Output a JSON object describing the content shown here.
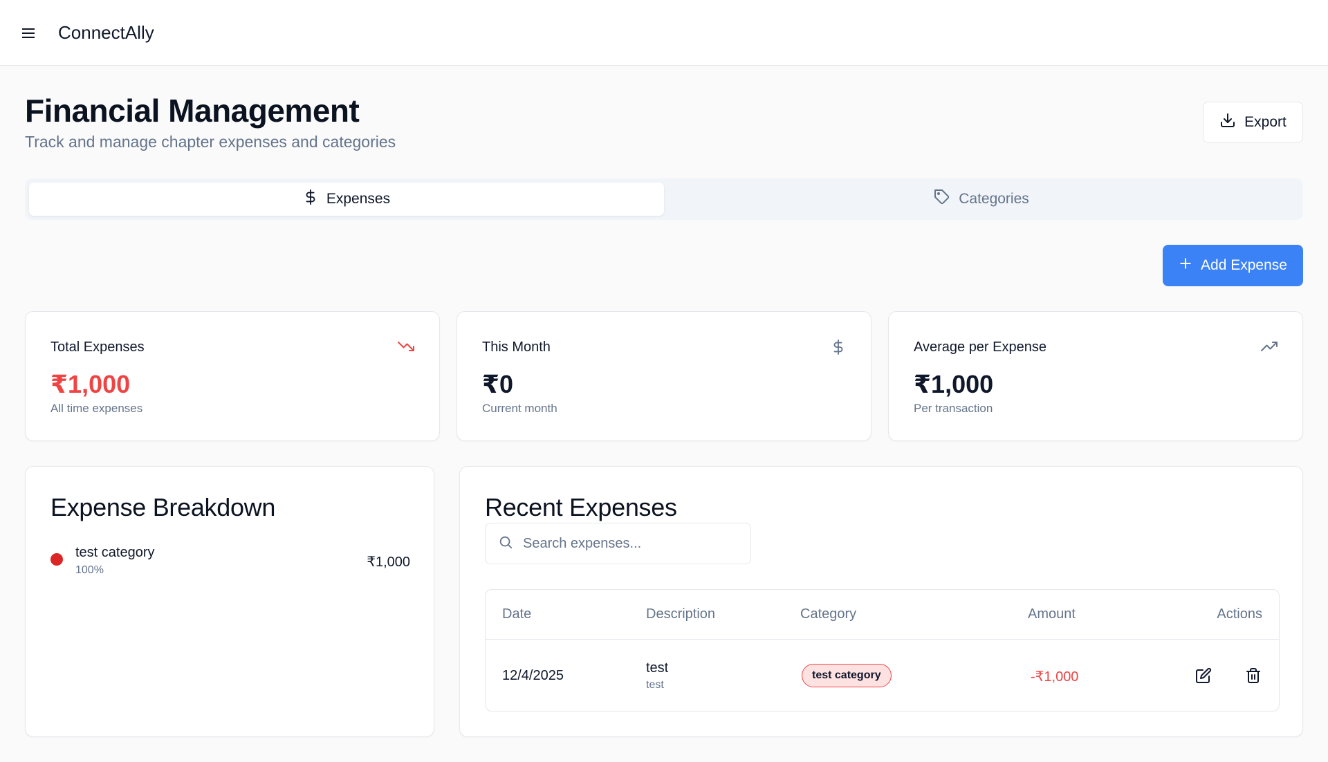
{
  "header": {
    "app_title": "ConnectAlly",
    "menu_icon": "hamburger-menu-icon"
  },
  "page": {
    "title": "Financial Management",
    "subtitle": "Track and manage chapter expenses and categories",
    "export_label": "Export"
  },
  "tabs": [
    {
      "label": "Expenses",
      "icon": "dollar-icon",
      "active": true
    },
    {
      "label": "Categories",
      "icon": "tag-icon",
      "active": false
    }
  ],
  "actions": {
    "add_expense_label": "Add Expense"
  },
  "stats": [
    {
      "label": "Total Expenses",
      "value": "₹1,000",
      "sub": "All time expenses",
      "icon": "trending-down-icon",
      "value_color": "#ef4444",
      "icon_color": "#ef4444"
    },
    {
      "label": "This Month",
      "value": "₹0",
      "sub": "Current month",
      "icon": "dollar-icon",
      "value_color": "#0f172a",
      "icon_color": "#64748b"
    },
    {
      "label": "Average per Expense",
      "value": "₹1,000",
      "sub": "Per transaction",
      "icon": "trending-up-icon",
      "value_color": "#0f172a",
      "icon_color": "#64748b"
    }
  ],
  "breakdown": {
    "title": "Expense Breakdown",
    "items": [
      {
        "name": "test category",
        "percent": "100%",
        "amount": "₹1,000",
        "color": "#dc2626"
      }
    ]
  },
  "recent": {
    "title": "Recent Expenses",
    "search_placeholder": "Search expenses...",
    "columns": [
      "Date",
      "Description",
      "Category",
      "Amount",
      "Actions"
    ],
    "rows": [
      {
        "date": "12/4/2025",
        "description": "test",
        "description_sub": "test",
        "category": "test category",
        "amount": "-₹1,000"
      }
    ]
  },
  "colors": {
    "primary": "#3b82f6",
    "danger": "#ef4444",
    "muted": "#64748b"
  }
}
